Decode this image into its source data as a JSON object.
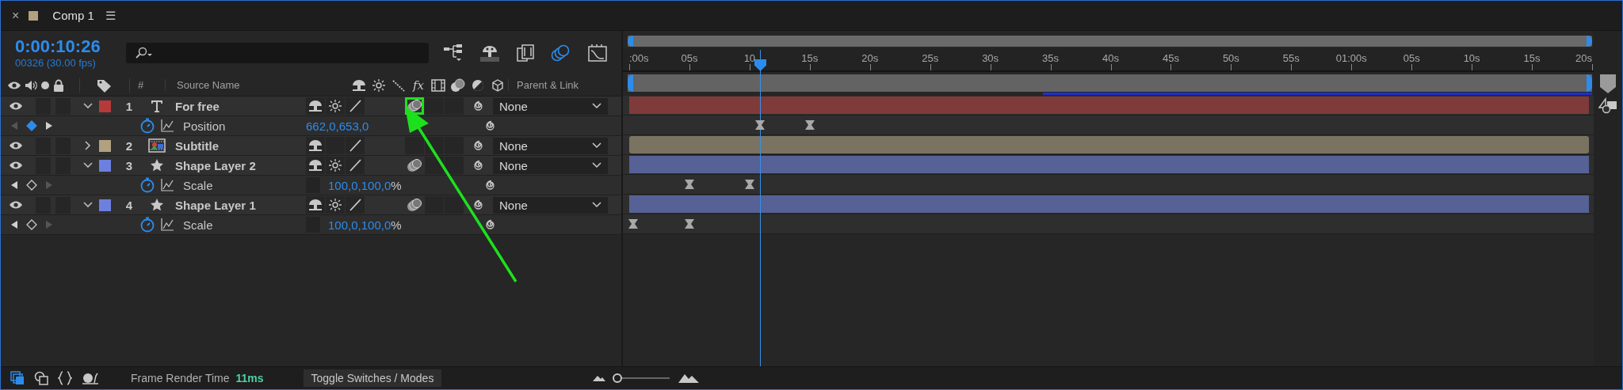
{
  "tab": {
    "close": "×",
    "title": "Comp 1",
    "menu": "☰"
  },
  "time": {
    "current": "0:00:10:26",
    "frames": "00326 (30.00 fps)"
  },
  "toolbar": [
    {
      "kind": "flowchart",
      "on": false
    },
    {
      "kind": "shy",
      "on": false
    },
    {
      "kind": "frame_blend",
      "on": false
    },
    {
      "kind": "motion_blur",
      "on": true
    },
    {
      "kind": "graph",
      "on": false
    }
  ],
  "columns": {
    "number": "#",
    "source_name": "Source Name",
    "fx": "fx",
    "parent": "Parent & Link"
  },
  "layers": [
    {
      "number": "1",
      "name": "For free",
      "kind": "text",
      "color": "#b73a3a",
      "visible": true,
      "expanded": true,
      "collapse_switch": true,
      "motion_blur": true,
      "adjustment": false,
      "three_d": false,
      "annotated": true,
      "parent": "None",
      "properties": [
        {
          "name": "Position",
          "kind": "position",
          "value": "662,0,653,0",
          "keyframe_at_time": true,
          "prev_keyframe": false,
          "next_keyframe": true
        }
      ]
    },
    {
      "number": "2",
      "name": "Subtitle",
      "kind": "precomp",
      "color": "#b1a181",
      "visible": true,
      "expanded": false,
      "collapse_switch": false,
      "motion_blur": false,
      "adjustment": false,
      "three_d": false,
      "annotated": false,
      "parent": "None"
    },
    {
      "number": "3",
      "name": "Shape Layer 2",
      "kind": "shape",
      "color": "#6d80e0",
      "visible": true,
      "expanded": true,
      "collapse_switch": true,
      "motion_blur": true,
      "adjustment": false,
      "three_d": false,
      "annotated": false,
      "parent": "None",
      "properties": [
        {
          "name": "Scale",
          "kind": "scale",
          "value": "100,0,100,0",
          "unit": "%",
          "keyframe_at_time": false,
          "prev_keyframe": true,
          "next_keyframe": false
        }
      ]
    },
    {
      "number": "4",
      "name": "Shape Layer 1",
      "kind": "shape",
      "color": "#6d80e0",
      "visible": true,
      "expanded": true,
      "collapse_switch": true,
      "motion_blur": true,
      "adjustment": false,
      "three_d": false,
      "annotated": false,
      "parent": "None",
      "properties": [
        {
          "name": "Scale",
          "kind": "scale",
          "value": "100,0,100,0",
          "unit": "%",
          "keyframe_at_time": false,
          "prev_keyframe": true,
          "next_keyframe": false
        }
      ]
    }
  ],
  "ruler": {
    "labels": [
      ":00s",
      "05s",
      "10",
      "15s",
      "20s",
      "25s",
      "30s",
      "35s",
      "40s",
      "45s",
      "50s",
      "55s",
      "01:00s",
      "05s",
      "10s",
      "15s",
      "20s"
    ]
  },
  "footer": {
    "buttons": [
      {
        "kind": "comp",
        "on": true
      },
      {
        "kind": "shapes",
        "on": false
      },
      {
        "kind": "brackets",
        "on": false
      },
      {
        "kind": "snail",
        "on": false
      }
    ],
    "render_label": "Frame Render Time",
    "render_time": "11ms",
    "toggle": "Toggle Switches / Modes",
    "zoom": {
      "level": 0.05
    }
  }
}
